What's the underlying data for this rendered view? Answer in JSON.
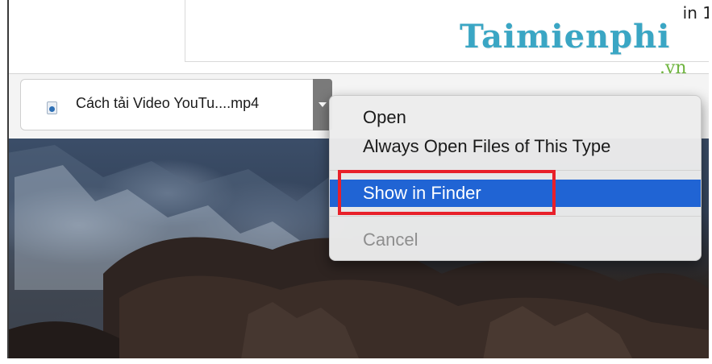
{
  "page": {
    "corner_text": "in 1"
  },
  "watermark": {
    "brand": "Taimienphi",
    "suffix": ".vn"
  },
  "downloads": {
    "file_name": "Cách tải Video YouTu....mp4"
  },
  "context_menu": {
    "items": [
      {
        "label": "Open"
      },
      {
        "label": "Always Open Files of This Type"
      },
      {
        "label": "Show in Finder",
        "state": "highlighted"
      },
      {
        "label": "Cancel",
        "state": "disabled"
      }
    ]
  },
  "colors": {
    "selection": "#2064d4",
    "annotation_box": "#e8202a",
    "watermark": "#3aa6c4",
    "watermark_suffix": "#6fb43f"
  },
  "icons": {
    "file": "video-file-icon",
    "dropdown": "chevron-down-icon"
  }
}
